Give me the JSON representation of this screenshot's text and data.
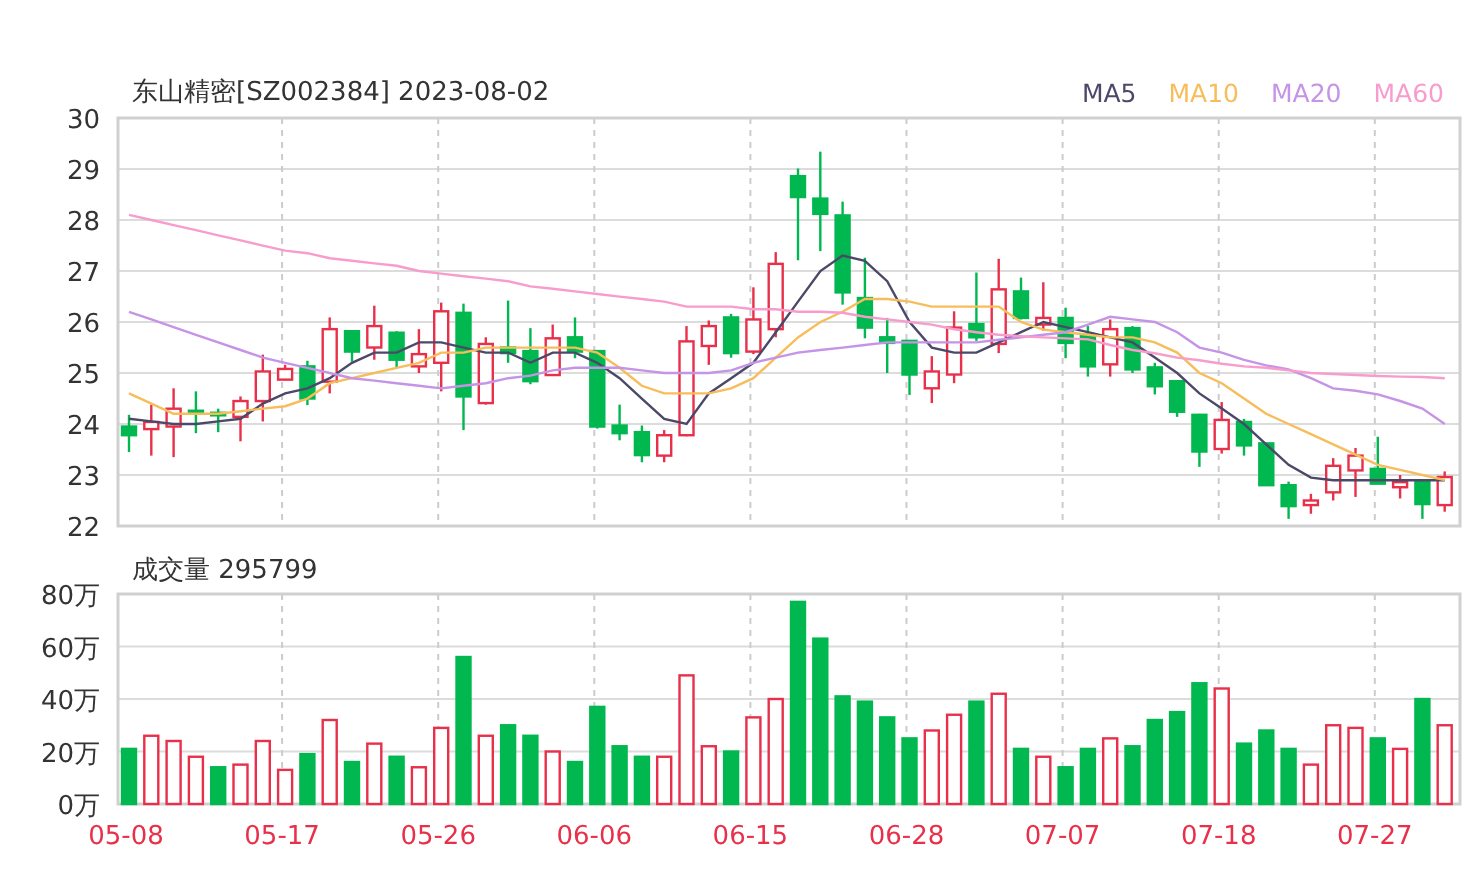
{
  "title": "东山精密[SZ002384] 2023-08-02",
  "price_chart": {
    "chart_data": {
      "type": "candlestick",
      "grid": true,
      "ylim": [
        22,
        30
      ],
      "yticks": [
        22,
        23,
        24,
        25,
        26,
        27,
        28,
        29,
        30
      ],
      "categories": [
        null,
        null,
        null,
        null,
        null,
        null,
        null,
        null,
        null,
        null,
        null,
        null,
        null,
        null,
        null,
        null,
        null,
        null,
        null,
        null,
        null,
        null,
        null,
        null,
        null,
        null,
        null,
        null,
        null,
        null,
        null,
        null,
        null,
        null,
        null,
        null,
        null,
        null,
        null,
        null,
        null,
        null,
        null,
        null,
        null,
        null,
        null,
        null,
        null,
        null,
        null,
        null,
        null,
        null,
        null,
        null,
        null,
        null,
        null,
        null
      ],
      "series": [
        {
          "name": "MA5",
          "type": "line",
          "color": "#4b4868",
          "values": [
            24.1,
            24.05,
            24.0,
            24.0,
            24.05,
            24.1,
            24.4,
            24.6,
            24.7,
            24.9,
            25.2,
            25.4,
            25.4,
            25.6,
            25.6,
            25.5,
            25.4,
            25.4,
            25.2,
            25.4,
            25.4,
            25.2,
            24.9,
            24.5,
            24.1,
            24.0,
            24.6,
            24.9,
            25.2,
            25.8,
            26.4,
            27.0,
            27.3,
            27.2,
            26.8,
            26.0,
            25.5,
            25.4,
            25.4,
            25.6,
            25.8,
            26.0,
            25.9,
            25.8,
            25.7,
            25.6,
            25.3,
            25.0,
            24.6,
            24.3,
            24.0,
            23.6,
            23.2,
            22.95,
            22.9,
            22.9,
            22.9,
            22.9,
            22.9,
            22.9
          ]
        },
        {
          "name": "MA10",
          "type": "line",
          "color": "#f7bd5a",
          "values": [
            24.6,
            24.4,
            24.2,
            24.2,
            24.2,
            24.25,
            24.3,
            24.35,
            24.5,
            24.8,
            24.9,
            25.0,
            25.1,
            25.2,
            25.4,
            25.4,
            25.5,
            25.5,
            25.5,
            25.5,
            25.5,
            25.4,
            25.1,
            24.75,
            24.6,
            24.6,
            24.6,
            24.7,
            24.9,
            25.3,
            25.7,
            26.0,
            26.2,
            26.45,
            26.45,
            26.4,
            26.3,
            26.3,
            26.3,
            26.3,
            26.0,
            25.85,
            25.8,
            25.75,
            25.7,
            25.7,
            25.6,
            25.4,
            25.0,
            24.8,
            24.5,
            24.2,
            24.0,
            23.8,
            23.6,
            23.4,
            23.2,
            23.1,
            23.0,
            22.9
          ]
        },
        {
          "name": "MA20",
          "type": "line",
          "color": "#c594e6",
          "values": [
            26.2,
            26.05,
            25.9,
            25.75,
            25.6,
            25.45,
            25.3,
            25.2,
            25.1,
            25.0,
            24.9,
            24.85,
            24.8,
            24.75,
            24.7,
            24.75,
            24.8,
            24.9,
            24.95,
            25.05,
            25.1,
            25.1,
            25.1,
            25.05,
            25.0,
            25.0,
            25.0,
            25.05,
            25.2,
            25.3,
            25.4,
            25.45,
            25.5,
            25.55,
            25.6,
            25.6,
            25.6,
            25.6,
            25.6,
            25.65,
            25.7,
            25.75,
            25.8,
            25.95,
            26.1,
            26.05,
            26.0,
            25.8,
            25.5,
            25.4,
            25.26,
            25.15,
            25.07,
            24.9,
            24.7,
            24.65,
            24.58,
            24.45,
            24.3,
            24.0
          ]
        },
        {
          "name": "MA60",
          "type": "line",
          "color": "#f79ccd",
          "values": [
            28.1,
            28.0,
            27.9,
            27.8,
            27.7,
            27.6,
            27.5,
            27.4,
            27.35,
            27.25,
            27.2,
            27.15,
            27.1,
            27.0,
            26.95,
            26.9,
            26.85,
            26.8,
            26.7,
            26.65,
            26.6,
            26.55,
            26.5,
            26.45,
            26.4,
            26.3,
            26.3,
            26.3,
            26.25,
            26.25,
            26.2,
            26.2,
            26.18,
            26.1,
            26.05,
            26.0,
            25.95,
            25.86,
            25.8,
            25.75,
            25.72,
            25.7,
            25.68,
            25.66,
            25.55,
            25.45,
            25.39,
            25.3,
            25.25,
            25.18,
            25.13,
            25.1,
            25.05,
            25.0,
            24.98,
            24.96,
            24.94,
            24.93,
            24.92,
            24.9
          ]
        }
      ],
      "ohlc": [
        [
          23.95,
          24.18,
          23.45,
          23.78
        ],
        [
          23.9,
          24.38,
          23.38,
          24.04
        ],
        [
          23.95,
          24.7,
          23.35,
          24.3
        ],
        [
          24.26,
          24.64,
          23.82,
          24.21
        ],
        [
          24.22,
          24.3,
          23.84,
          24.17
        ],
        [
          24.14,
          24.54,
          23.66,
          24.45
        ],
        [
          24.45,
          25.36,
          24.05,
          25.03
        ],
        [
          24.87,
          25.16,
          24.87,
          25.08
        ],
        [
          25.13,
          25.24,
          24.37,
          24.5
        ],
        [
          24.83,
          26.09,
          24.6,
          25.86
        ],
        [
          25.82,
          25.82,
          25.22,
          25.42
        ],
        [
          25.5,
          26.32,
          25.26,
          25.92
        ],
        [
          25.79,
          25.82,
          25.09,
          25.26
        ],
        [
          25.13,
          25.86,
          25.0,
          25.37
        ],
        [
          25.2,
          26.38,
          24.64,
          26.21
        ],
        [
          26.18,
          26.36,
          23.88,
          24.54
        ],
        [
          24.41,
          25.7,
          24.38,
          25.57
        ],
        [
          25.5,
          26.42,
          25.2,
          25.39
        ],
        [
          25.43,
          25.88,
          24.78,
          24.84
        ],
        [
          24.96,
          25.95,
          24.94,
          25.68
        ],
        [
          25.7,
          26.09,
          25.29,
          25.42
        ],
        [
          25.43,
          25.43,
          23.91,
          23.95
        ],
        [
          23.97,
          24.38,
          23.68,
          23.82
        ],
        [
          23.84,
          23.97,
          23.25,
          23.39
        ],
        [
          23.38,
          23.88,
          23.25,
          23.78
        ],
        [
          23.78,
          25.92,
          23.76,
          25.62
        ],
        [
          25.53,
          26.03,
          25.16,
          25.92
        ],
        [
          26.09,
          26.16,
          25.3,
          25.39
        ],
        [
          25.42,
          26.68,
          25.37,
          26.05
        ],
        [
          25.86,
          27.37,
          25.7,
          27.14
        ],
        [
          28.86,
          29.01,
          27.21,
          28.45
        ],
        [
          28.42,
          29.34,
          27.39,
          28.12
        ],
        [
          28.09,
          28.36,
          26.34,
          26.58
        ],
        [
          26.47,
          27.26,
          25.68,
          25.89
        ],
        [
          25.7,
          26.08,
          25.0,
          25.59
        ],
        [
          25.63,
          25.63,
          24.57,
          24.97
        ],
        [
          24.7,
          25.33,
          24.41,
          25.03
        ],
        [
          24.97,
          26.21,
          24.8,
          25.89
        ],
        [
          25.96,
          26.97,
          25.63,
          25.7
        ],
        [
          25.57,
          27.24,
          25.39,
          26.64
        ],
        [
          26.6,
          26.87,
          26.05,
          26.08
        ],
        [
          25.95,
          26.78,
          25.83,
          26.08
        ],
        [
          26.08,
          26.28,
          25.29,
          25.59
        ],
        [
          25.75,
          25.92,
          24.93,
          25.13
        ],
        [
          25.17,
          26.05,
          24.93,
          25.86
        ],
        [
          25.88,
          25.92,
          25.0,
          25.07
        ],
        [
          25.11,
          25.2,
          24.58,
          24.74
        ],
        [
          24.84,
          24.86,
          24.14,
          24.24
        ],
        [
          24.18,
          24.2,
          23.16,
          23.46
        ],
        [
          23.51,
          24.43,
          23.42,
          24.08
        ],
        [
          24.04,
          24.1,
          23.38,
          23.58
        ],
        [
          23.62,
          23.62,
          22.8,
          22.8
        ],
        [
          22.8,
          22.87,
          22.14,
          22.39
        ],
        [
          22.41,
          22.63,
          22.24,
          22.5
        ],
        [
          22.66,
          23.33,
          22.5,
          23.18
        ],
        [
          23.09,
          23.53,
          22.57,
          23.38
        ],
        [
          23.12,
          23.75,
          22.83,
          22.83
        ],
        [
          22.76,
          23.0,
          22.54,
          22.86
        ],
        [
          22.86,
          22.88,
          22.14,
          22.43
        ],
        [
          22.41,
          23.07,
          22.28,
          22.96
        ]
      ]
    }
  },
  "volume_chart": {
    "title": "成交量 295799",
    "chart_data": {
      "type": "bar",
      "stacked": true,
      "grid": true,
      "ylim": [
        0,
        80
      ],
      "categories": [
        "05-08",
        null,
        null,
        null,
        null,
        null,
        null,
        "05-17",
        null,
        null,
        null,
        null,
        null,
        null,
        "05-26",
        null,
        null,
        null,
        null,
        null,
        null,
        "06-06",
        null,
        null,
        null,
        null,
        null,
        null,
        "06-15",
        null,
        null,
        null,
        null,
        null,
        null,
        "06-28",
        null,
        null,
        null,
        null,
        null,
        null,
        "07-07",
        null,
        null,
        null,
        null,
        null,
        null,
        "07-18",
        null,
        null,
        null,
        null,
        null,
        null,
        "07-27",
        null,
        null,
        null
      ],
      "yticks": [
        {
          "value": 0,
          "label": "0万"
        },
        {
          "value": 20,
          "label": "20万"
        },
        {
          "value": 40,
          "label": "40万"
        },
        {
          "value": 60,
          "label": "60万"
        },
        {
          "value": 80,
          "label": "80万"
        }
      ],
      "series": [
        {
          "color": "#e8304a",
          "values": [
            null,
            26,
            24,
            18,
            null,
            15,
            24,
            13,
            null,
            32,
            null,
            23,
            null,
            14,
            29,
            null,
            26,
            null,
            null,
            20,
            null,
            null,
            null,
            null,
            18,
            49,
            22,
            null,
            33,
            40,
            null,
            null,
            null,
            null,
            null,
            null,
            28,
            34,
            null,
            42,
            null,
            18,
            null,
            null,
            25,
            null,
            null,
            null,
            null,
            44,
            null,
            null,
            null,
            15,
            30,
            29,
            null,
            21,
            null,
            30
          ]
        },
        {
          "color": "#00b84f",
          "values": [
            21,
            null,
            null,
            null,
            14,
            null,
            null,
            null,
            19,
            null,
            16,
            null,
            18,
            null,
            null,
            56,
            null,
            30,
            26,
            null,
            16,
            37,
            22,
            18,
            null,
            null,
            null,
            20,
            null,
            null,
            77,
            63,
            41,
            39,
            33,
            25,
            null,
            null,
            39,
            null,
            21,
            null,
            14,
            21,
            null,
            22,
            32,
            35,
            46,
            null,
            23,
            28,
            21,
            null,
            null,
            null,
            25,
            null,
            40,
            null
          ]
        }
      ]
    }
  }
}
